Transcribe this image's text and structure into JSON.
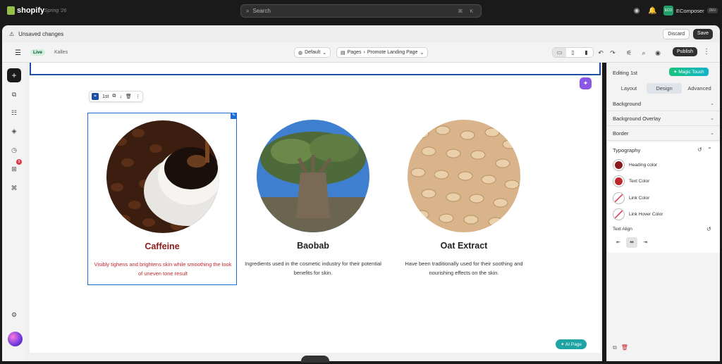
{
  "topbar": {
    "brand": "shopify",
    "edition": "Spring '26",
    "search_placeholder": "Search",
    "search_shortcut": "⌘ K",
    "store_initials": "ECO",
    "store_name": "EComposer",
    "store_tag": "dev"
  },
  "unsaved": {
    "text": "Unsaved changes",
    "discard": "Discard",
    "save": "Save"
  },
  "editor": {
    "status": "Live",
    "theme": "Kalles",
    "device_select": "Default",
    "pages_label": "Pages",
    "page_name": "Promote Landing Page",
    "publish": "Publish"
  },
  "sidebar": {
    "notification_count": "9"
  },
  "canvas": {
    "element_tag": "1st",
    "cards": [
      {
        "title": "Caffeine",
        "desc": "Visibly tighens and brightens skin while smoothing the look of uneven tone result"
      },
      {
        "title": "Baobab",
        "desc": "Ingredients used in the cosmetic industry for their potential benefits for skin."
      },
      {
        "title": "Oat Extract",
        "desc": "Have been traditionally used for their soothing and nourishing effects on the skin."
      }
    ],
    "ai_button": "AI Page"
  },
  "panel": {
    "editing": "Editing 1st",
    "magic": "Magic Touch",
    "tabs": [
      "Layout",
      "Design",
      "Advanced"
    ],
    "active_tab": "Design",
    "sections": [
      "Background",
      "Background Overlay",
      "Border"
    ],
    "typography": {
      "title": "Typography",
      "colors": [
        {
          "label": "Heading color",
          "color": "#8b1b1b"
        },
        {
          "label": "Text Color",
          "color": "#c0282d"
        },
        {
          "label": "Link Color",
          "color": "none"
        },
        {
          "label": "Link Hover Color",
          "color": "none"
        }
      ],
      "text_align_label": "Text Align"
    }
  }
}
